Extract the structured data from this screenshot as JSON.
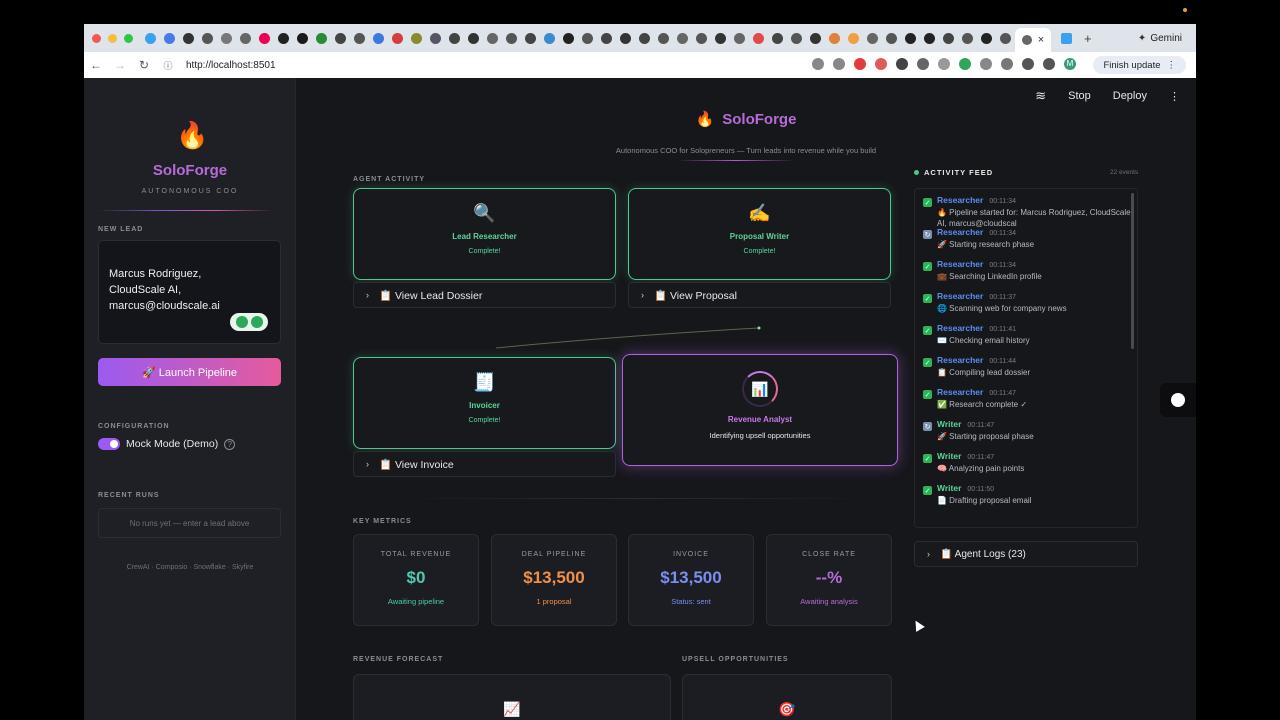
{
  "browser": {
    "url": "http://localhost:8501",
    "finish_update": "Finish update",
    "gemini": "Gemini",
    "tab_close": "×",
    "new_tab": "+",
    "avatar_initial": "M"
  },
  "header": {
    "stop": "Stop",
    "deploy": "Deploy",
    "more": "⋮"
  },
  "sidebar": {
    "fire": "🔥",
    "brand": "SoloForge",
    "tagline": "AUTONOMOUS COO",
    "new_lead_label": "NEW LEAD",
    "lead_text": "Marcus Rodriguez,\nCloudScale AI,\nmarcus@cloudscale.ai",
    "launch_label": "🚀 Launch Pipeline",
    "config_label": "CONFIGURATION",
    "mock_mode_label": "Mock Mode (Demo)",
    "help": "?",
    "recent_runs_label": "RECENT RUNS",
    "no_runs": "No runs yet — enter a lead above",
    "credits": "CrewAI · Composio · Snowflake · Skyfire"
  },
  "main": {
    "fire": "🔥",
    "title": "SoloForge",
    "subtitle": "Autonomous COO for Solopreneurs — Turn leads into revenue while you build",
    "agent_activity_label": "AGENT ACTIVITY",
    "agents": [
      {
        "icon": "🔍",
        "name": "Lead Researcher",
        "status": "Complete!"
      },
      {
        "icon": "✍️",
        "name": "Proposal Writer",
        "status": "Complete!"
      },
      {
        "icon": "🧾",
        "name": "Invoicer",
        "status": "Complete!"
      },
      {
        "icon": "📊",
        "name": "Revenue Analyst",
        "status": "Identifying upsell opportunities"
      }
    ],
    "expanders": {
      "dossier": "📋 View Lead Dossier",
      "proposal": "📋 View Proposal",
      "invoice": "📋 View Invoice",
      "chevron": "›"
    },
    "key_metrics_label": "KEY METRICS",
    "metrics": [
      {
        "label": "TOTAL REVENUE",
        "value": "$0",
        "note": "Awaiting pipeline",
        "color": "#4ec9b0"
      },
      {
        "label": "DEAL PIPELINE",
        "value": "$13,500",
        "note": "1 proposal",
        "color": "#f0904a"
      },
      {
        "label": "INVOICE",
        "value": "$13,500",
        "note": "Status: sent",
        "color": "#7a8ef0"
      },
      {
        "label": "CLOSE RATE",
        "value": "--%",
        "note": "Awaiting analysis",
        "color": "#b66cd8"
      }
    ],
    "revenue_forecast_label": "REVENUE FORECAST",
    "upsell_label": "UPSELL OPPORTUNITIES",
    "forecast_icon": "📈",
    "upsell_icon": "🎯"
  },
  "feed": {
    "title": "ACTIVITY FEED",
    "count": "22 events",
    "items": [
      {
        "agent": "Researcher",
        "time": "00:11:34",
        "text": "🔥 Pipeline started for: Marcus Rodriguez, CloudScale AI, marcus@cloudscal",
        "kind": "done",
        "mark": "✓"
      },
      {
        "agent": "Researcher",
        "time": "00:11:34",
        "text": "🚀 Starting research phase",
        "kind": "info",
        "mark": "↻"
      },
      {
        "agent": "Researcher",
        "time": "00:11:34",
        "text": "💼 Searching LinkedIn profile",
        "kind": "done",
        "mark": "✓"
      },
      {
        "agent": "Researcher",
        "time": "00:11:37",
        "text": "🌐 Scanning web for company news",
        "kind": "done",
        "mark": "✓"
      },
      {
        "agent": "Researcher",
        "time": "00:11:41",
        "text": "✉️ Checking email history",
        "kind": "done",
        "mark": "✓"
      },
      {
        "agent": "Researcher",
        "time": "00:11:44",
        "text": "📋 Compiling lead dossier",
        "kind": "done",
        "mark": "✓"
      },
      {
        "agent": "Researcher",
        "time": "00:11:47",
        "text": "✅ Research complete ✓",
        "kind": "done",
        "mark": "✓"
      },
      {
        "agent": "Writer",
        "time": "00:11:47",
        "text": "🚀 Starting proposal phase",
        "kind": "info",
        "mark": "↻"
      },
      {
        "agent": "Writer",
        "time": "00:11:47",
        "text": "🧠 Analyzing pain points",
        "kind": "done",
        "mark": "✓"
      },
      {
        "agent": "Writer",
        "time": "00:11:50",
        "text": "📄 Drafting proposal email",
        "kind": "done",
        "mark": "✓"
      }
    ],
    "agent_logs": "📋 Agent Logs (23)"
  },
  "colors": {
    "researcher": "#5b8df0",
    "writer": "#5cd69a"
  }
}
